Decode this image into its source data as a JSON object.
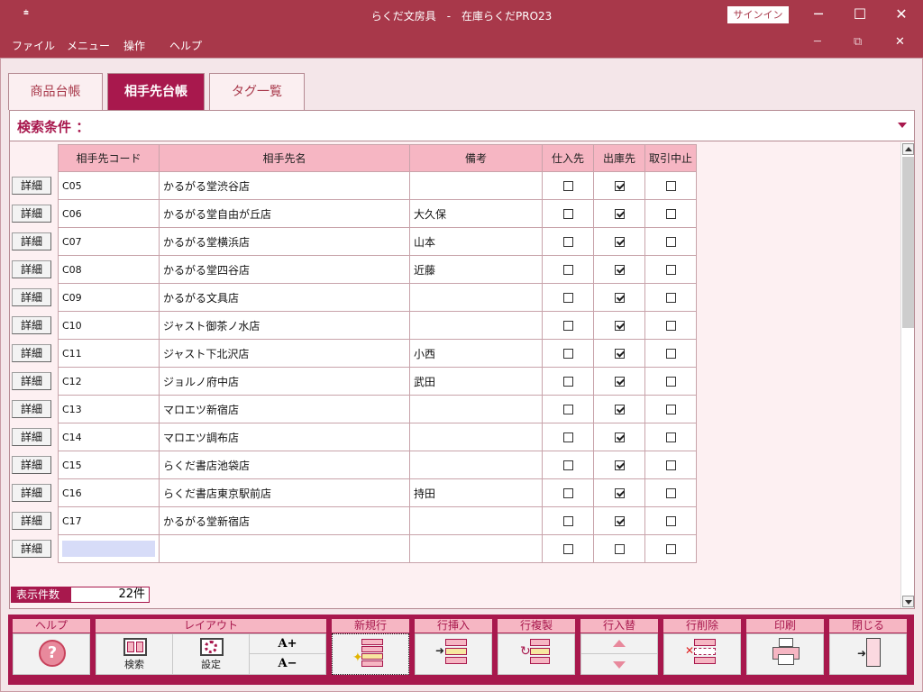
{
  "window": {
    "title": "らくだ文房具　-　在庫らくだPRO23",
    "signin_label": "サインイン",
    "system_menu_glyph": "⩧",
    "minimize_glyph": "─",
    "maximize_glyph": "☐",
    "close_glyph": "✕",
    "inner_minimize_glyph": "─",
    "inner_restore_glyph": "⧉",
    "inner_close_glyph": "✕"
  },
  "menu": {
    "items": [
      "ファイル",
      "メニュー",
      "操作",
      "ヘルプ"
    ]
  },
  "tabs": [
    {
      "label": "商品台帳",
      "active": false
    },
    {
      "label": "相手先台帳",
      "active": true
    },
    {
      "label": "タグ一覧",
      "active": false
    }
  ],
  "search": {
    "label": "検索条件 ："
  },
  "table": {
    "columns": [
      "相手先コード",
      "相手先名",
      "備考",
      "仕入先",
      "出庫先",
      "取引中止"
    ],
    "detail_label": "詳細",
    "rows": [
      {
        "code": "C05",
        "name": "かるがる堂渋谷店",
        "note": "",
        "supplier": false,
        "shipto": true,
        "suspended": false
      },
      {
        "code": "C06",
        "name": "かるがる堂自由が丘店",
        "note": "大久保",
        "supplier": false,
        "shipto": true,
        "suspended": false
      },
      {
        "code": "C07",
        "name": "かるがる堂横浜店",
        "note": "山本",
        "supplier": false,
        "shipto": true,
        "suspended": false
      },
      {
        "code": "C08",
        "name": "かるがる堂四谷店",
        "note": "近藤",
        "supplier": false,
        "shipto": true,
        "suspended": false
      },
      {
        "code": "C09",
        "name": "かるがる文具店",
        "note": "",
        "supplier": false,
        "shipto": true,
        "suspended": false
      },
      {
        "code": "C10",
        "name": "ジャスト御茶ノ水店",
        "note": "",
        "supplier": false,
        "shipto": true,
        "suspended": false
      },
      {
        "code": "C11",
        "name": "ジャスト下北沢店",
        "note": "小西",
        "supplier": false,
        "shipto": true,
        "suspended": false
      },
      {
        "code": "C12",
        "name": "ジョルノ府中店",
        "note": "武田",
        "supplier": false,
        "shipto": true,
        "suspended": false
      },
      {
        "code": "C13",
        "name": "マロエツ新宿店",
        "note": "",
        "supplier": false,
        "shipto": true,
        "suspended": false
      },
      {
        "code": "C14",
        "name": "マロエツ調布店",
        "note": "",
        "supplier": false,
        "shipto": true,
        "suspended": false
      },
      {
        "code": "C15",
        "name": "らくだ書店池袋店",
        "note": "",
        "supplier": false,
        "shipto": true,
        "suspended": false
      },
      {
        "code": "C16",
        "name": "らくだ書店東京駅前店",
        "note": "持田",
        "supplier": false,
        "shipto": true,
        "suspended": false
      },
      {
        "code": "C17",
        "name": "かるがる堂新宿店",
        "note": "",
        "supplier": false,
        "shipto": true,
        "suspended": false
      },
      {
        "code": "",
        "name": "",
        "note": "",
        "supplier": false,
        "shipto": false,
        "suspended": false
      }
    ]
  },
  "count": {
    "label": "表示件数",
    "value": "22件"
  },
  "toolbar": {
    "help": {
      "title": "ヘルプ",
      "glyph": "?"
    },
    "layout": {
      "title": "レイアウト",
      "search_label": "検索",
      "settings_label": "設定",
      "font_up": "A+",
      "font_down": "A−"
    },
    "new_row": {
      "title": "新規行"
    },
    "insert_row": {
      "title": "行挿入"
    },
    "copy_row": {
      "title": "行複製"
    },
    "swap_row": {
      "title": "行入替"
    },
    "delete_row": {
      "title": "行削除"
    },
    "print": {
      "title": "印刷"
    },
    "close": {
      "title": "閉じる"
    }
  },
  "colors": {
    "titlebar": "#a8384a",
    "accent": "#a8184d",
    "header_pink": "#f6b6c3",
    "panel_bg": "#fdf0f2"
  }
}
